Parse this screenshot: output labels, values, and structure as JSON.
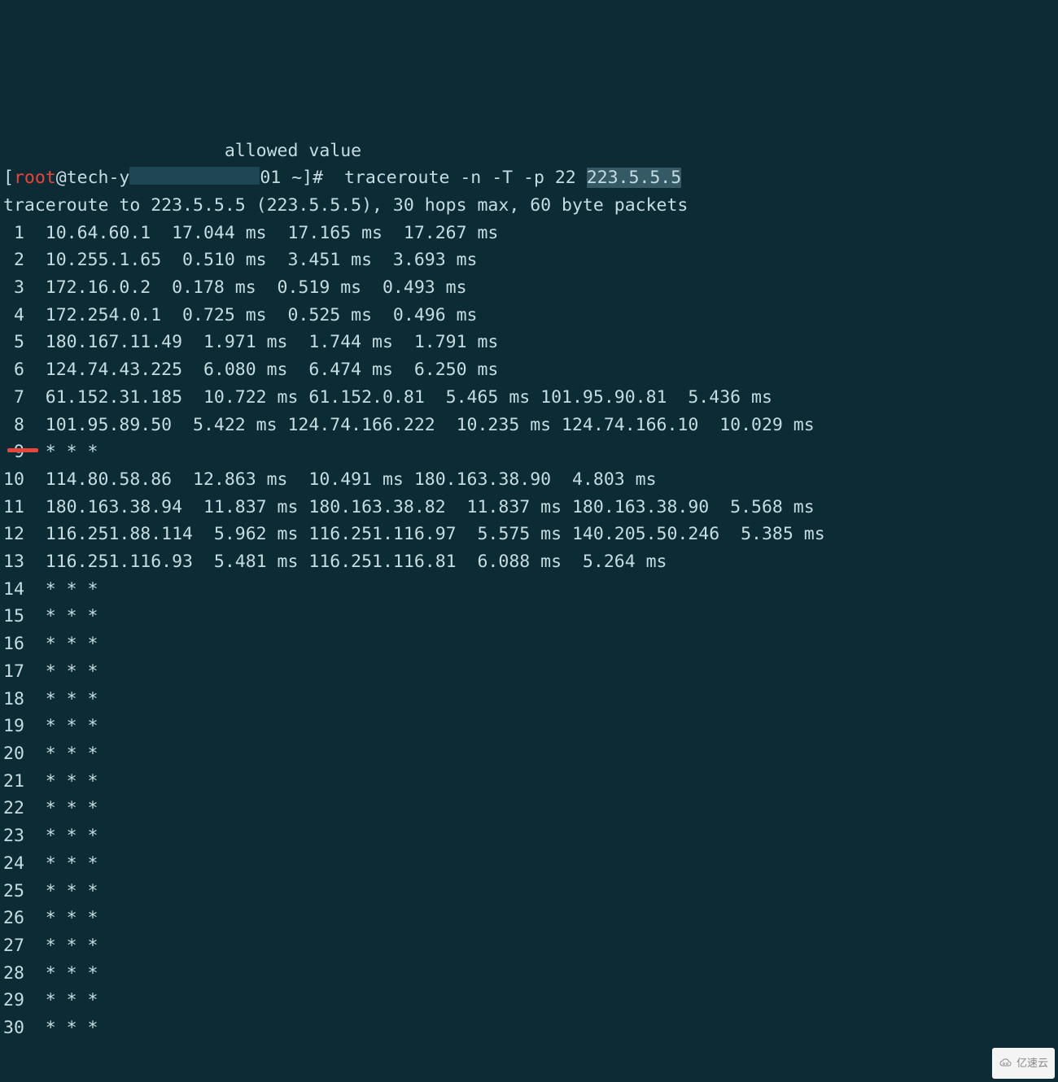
{
  "header_fragment": "allowed value",
  "prompt": {
    "user": "root",
    "host_prefix": "tech-y",
    "host_suffix": "01",
    "path": "~",
    "symbol": "#"
  },
  "command": {
    "name": "traceroute",
    "flags": "-n -T -p 22",
    "target_ip": "223.5.5.5"
  },
  "summary_line": "traceroute to 223.5.5.5 (223.5.5.5), 30 hops max, 60 byte packets",
  "hops": [
    {
      "n": 1,
      "text": "10.64.60.1  17.044 ms  17.165 ms  17.267 ms"
    },
    {
      "n": 2,
      "text": "10.255.1.65  0.510 ms  3.451 ms  3.693 ms"
    },
    {
      "n": 3,
      "text": "172.16.0.2  0.178 ms  0.519 ms  0.493 ms"
    },
    {
      "n": 4,
      "text": "172.254.0.1  0.725 ms  0.525 ms  0.496 ms"
    },
    {
      "n": 5,
      "text": "180.167.11.49  1.971 ms  1.744 ms  1.791 ms"
    },
    {
      "n": 6,
      "text": "124.74.43.225  6.080 ms  6.474 ms  6.250 ms"
    },
    {
      "n": 7,
      "text": "61.152.31.185  10.722 ms 61.152.0.81  5.465 ms 101.95.90.81  5.436 ms"
    },
    {
      "n": 8,
      "text": "101.95.89.50  5.422 ms 124.74.166.222  10.235 ms 124.74.166.10  10.029 ms"
    },
    {
      "n": 9,
      "text": "* * *"
    },
    {
      "n": 10,
      "text": "114.80.58.86  12.863 ms  10.491 ms 180.163.38.90  4.803 ms"
    },
    {
      "n": 11,
      "text": "180.163.38.94  11.837 ms 180.163.38.82  11.837 ms 180.163.38.90  5.568 ms"
    },
    {
      "n": 12,
      "text": "116.251.88.114  5.962 ms 116.251.116.97  5.575 ms 140.205.50.246  5.385 ms"
    },
    {
      "n": 13,
      "text": "116.251.116.93  5.481 ms 116.251.116.81  6.088 ms  5.264 ms"
    },
    {
      "n": 14,
      "text": "* * *"
    },
    {
      "n": 15,
      "text": "* * *"
    },
    {
      "n": 16,
      "text": "* * *"
    },
    {
      "n": 17,
      "text": "* * *"
    },
    {
      "n": 18,
      "text": "* * *"
    },
    {
      "n": 19,
      "text": "* * *"
    },
    {
      "n": 20,
      "text": "* * *"
    },
    {
      "n": 21,
      "text": "* * *"
    },
    {
      "n": 22,
      "text": "* * *"
    },
    {
      "n": 23,
      "text": "* * *"
    },
    {
      "n": 24,
      "text": "* * *"
    },
    {
      "n": 25,
      "text": "* * *"
    },
    {
      "n": 26,
      "text": "* * *"
    },
    {
      "n": 27,
      "text": "* * *"
    },
    {
      "n": 28,
      "text": "* * *"
    },
    {
      "n": 29,
      "text": "* * *"
    },
    {
      "n": 30,
      "text": "* * *"
    }
  ],
  "watermark": "亿速云"
}
